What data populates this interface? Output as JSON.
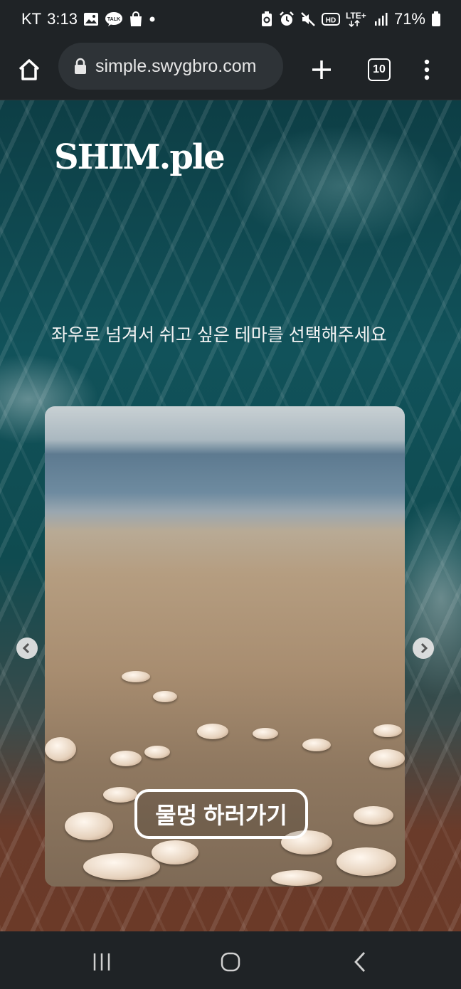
{
  "status_bar": {
    "carrier": "KT",
    "time": "3:13",
    "left_icons": [
      "gallery-icon",
      "kakaotalk-icon",
      "shopping-bag-icon",
      "dot-icon"
    ],
    "talk_badge": "TALK",
    "hd_label": "HD",
    "network_label": "LTE+",
    "battery": "71%"
  },
  "browser": {
    "url": "simple.swygbro.com",
    "tab_count": "10"
  },
  "page": {
    "logo": "SHIM.ple",
    "instruction": "좌우로 넘겨서 쉬고 싶은 테마를 선택해주세요",
    "carousel": {
      "current_theme_button": "물멍 하러가기"
    }
  }
}
